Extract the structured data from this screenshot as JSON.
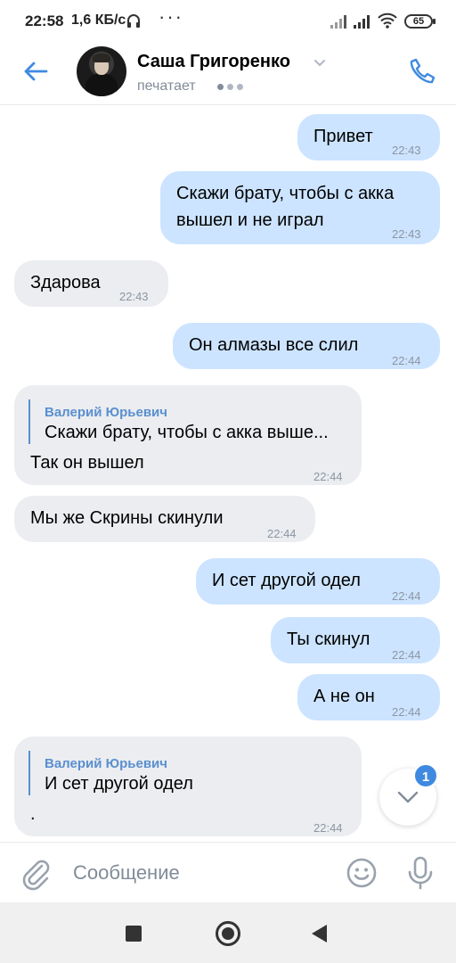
{
  "status_bar": {
    "time": "22:58",
    "speed": "1,6 КБ/с",
    "dots": "···",
    "battery": "65",
    "icons": [
      "headphones-icon",
      "signal-icon",
      "signal-icon",
      "wifi-icon",
      "battery-icon"
    ]
  },
  "header": {
    "name": "Саша Григоренко",
    "status": "печатает",
    "icons": [
      "back-arrow-icon",
      "avatar",
      "chevron-down-icon",
      "phone-icon"
    ]
  },
  "messages": [
    {
      "direction": "out",
      "text": "Привет",
      "time": "22:43"
    },
    {
      "direction": "out",
      "text_lines": [
        "Скажи брату, чтобы с акка",
        "вышел и не играл"
      ],
      "time": "22:43"
    },
    {
      "direction": "in",
      "text": "Здарова",
      "time": "22:43"
    },
    {
      "direction": "out",
      "text": "Он алмазы все слил",
      "time": "22:44"
    },
    {
      "direction": "in",
      "reply": {
        "author": "Валерий Юрьевич",
        "text": "Скажи брату, чтобы с акка выше..."
      },
      "text": "Так он вышел",
      "time": "22:44"
    },
    {
      "direction": "in",
      "text": "Мы же Скрины скинули",
      "time": "22:44"
    },
    {
      "direction": "out",
      "text": "И сет другой одел",
      "time": "22:44"
    },
    {
      "direction": "out",
      "text": "Ты скинул",
      "time": "22:44"
    },
    {
      "direction": "out",
      "text": "А не он",
      "time": "22:44"
    },
    {
      "direction": "in",
      "reply": {
        "author": "Валерий Юрьевич",
        "text": "И сет другой одел"
      },
      "text": ".",
      "time": "22:44"
    }
  ],
  "scroll_down": {
    "badge": "1"
  },
  "composer": {
    "placeholder": "Сообщение",
    "value": "",
    "icons": [
      "paperclip-icon",
      "emoji-icon",
      "microphone-icon"
    ]
  },
  "colors": {
    "outgoing_bubble": "#cce4ff",
    "incoming_bubble": "#ebedf0",
    "accent": "#3f8ae0",
    "reply_accent": "#5a8fd0",
    "timestamp": "#8c96a3"
  }
}
